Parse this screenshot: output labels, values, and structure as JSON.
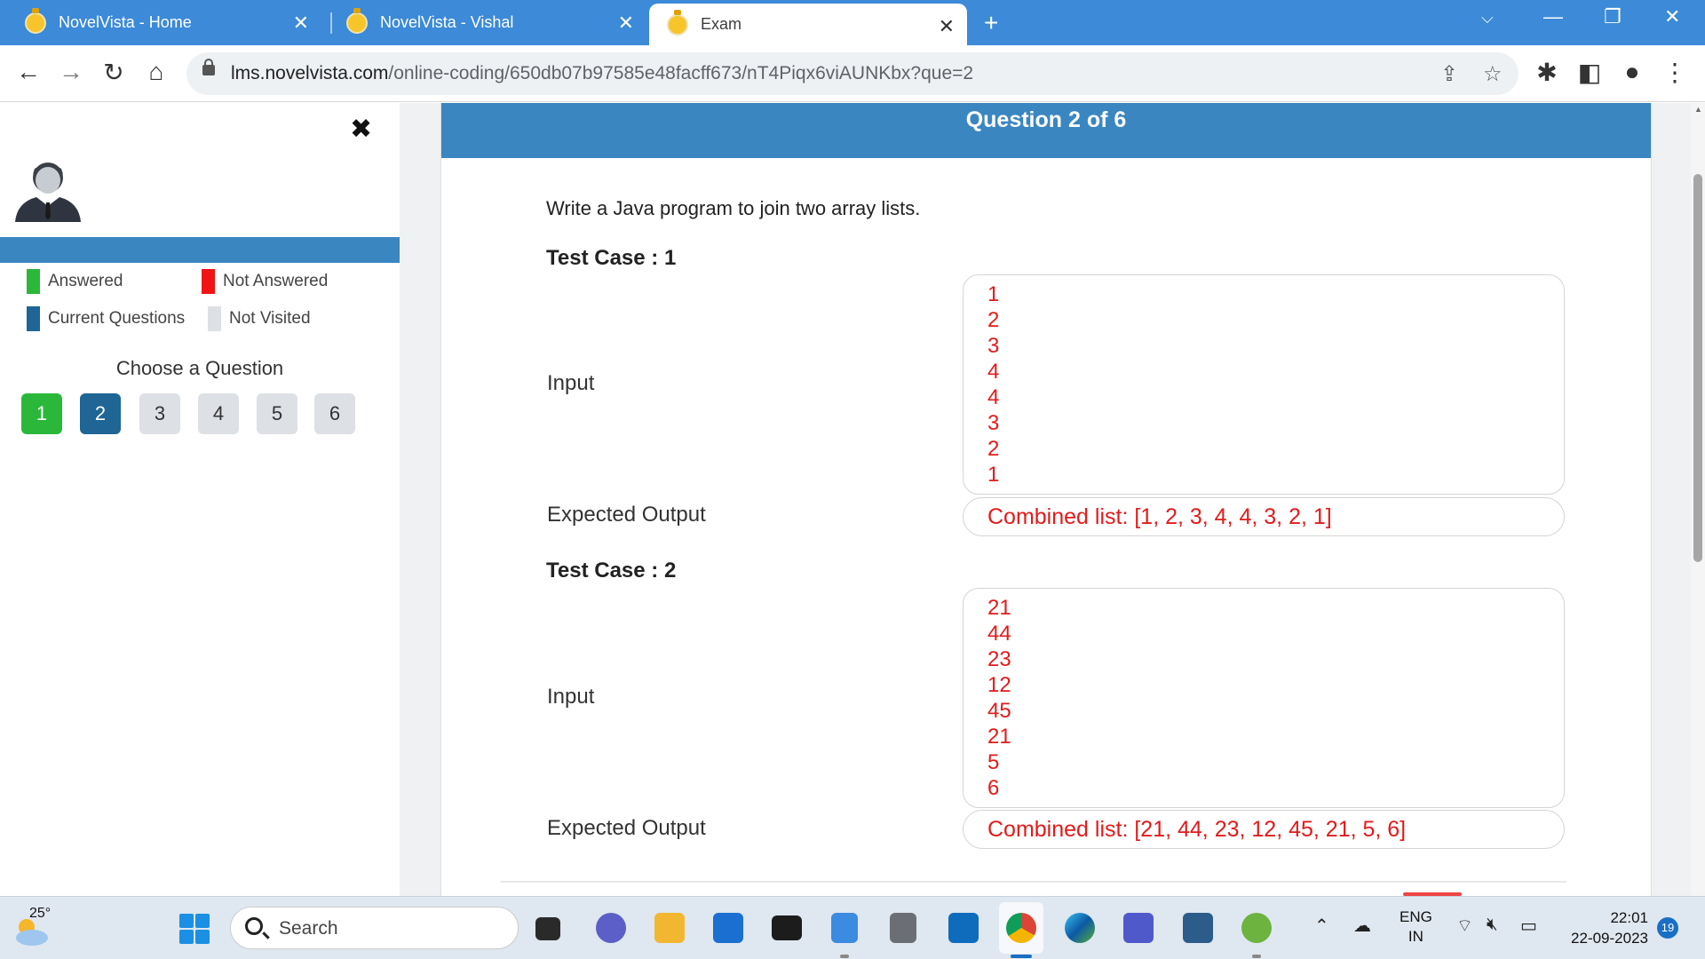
{
  "browser": {
    "tabs": [
      {
        "title": "NovelVista - Home",
        "active": false
      },
      {
        "title": "NovelVista - Vishal",
        "active": false
      },
      {
        "title": "Exam",
        "active": true
      }
    ],
    "url_host": "lms.novelvista.com",
    "url_path": "/online-coding/650db07b97585e48facff673/nT4Piqx6viAUNKbx?que=2"
  },
  "sidebar": {
    "legend": {
      "answered": "Answered",
      "not_answered": "Not Answered",
      "current": "Current Questions",
      "not_visited": "Not Visited"
    },
    "legend_colors": {
      "answered": "#2bb83a",
      "not_answered": "#f01414",
      "current": "#1f6595",
      "not_visited": "#dde0e4"
    },
    "choose_label": "Choose a Question",
    "questions": [
      {
        "label": "1",
        "state": "answered"
      },
      {
        "label": "2",
        "state": "current"
      },
      {
        "label": "3",
        "state": "not-visited"
      },
      {
        "label": "4",
        "state": "not-visited"
      },
      {
        "label": "5",
        "state": "not-visited"
      },
      {
        "label": "6",
        "state": "not-visited"
      }
    ]
  },
  "main": {
    "header": "Question 2 of 6",
    "question": "Write a Java program to join two array lists.",
    "input_label": "Input",
    "output_label": "Expected Output",
    "test_cases": [
      {
        "title": "Test Case : 1",
        "input": [
          "1",
          "2",
          "3",
          "4",
          "4",
          "3",
          "2",
          "1"
        ],
        "output": "Combined list: [1, 2, 3, 4, 4, 3, 2, 1]"
      },
      {
        "title": "Test Case : 2",
        "input": [
          "21",
          "44",
          "23",
          "12",
          "45",
          "21",
          "5",
          "6"
        ],
        "output": "Combined list: [21, 44, 23, 12, 45, 21, 5, 6]"
      }
    ]
  },
  "taskbar": {
    "temperature": "25°",
    "search_placeholder": "Search",
    "lang_line1": "ENG",
    "lang_line2": "IN",
    "time": "22:01",
    "date": "22-09-2023",
    "notification_count": "19"
  },
  "colors": {
    "header_blue": "#3a86c1",
    "browser_blue": "#3c8ad8",
    "io_red": "#e21b1b"
  }
}
